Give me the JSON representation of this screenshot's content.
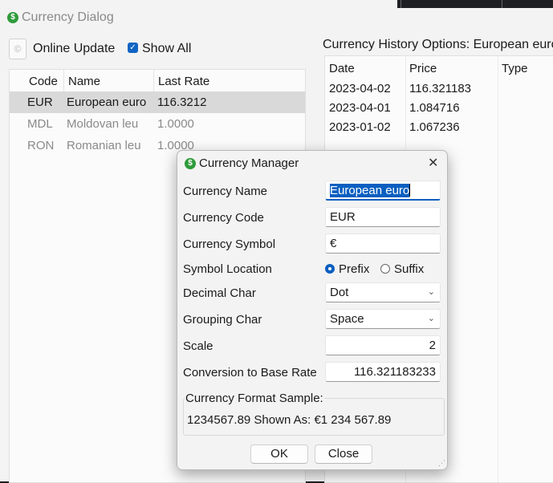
{
  "window": {
    "title": "Currency Dialog",
    "icon": "currency-coin-icon"
  },
  "toolbar": {
    "online_update_label": "Online Update",
    "show_all_label": "Show All",
    "show_all_checked": true
  },
  "currency_list": {
    "columns": [
      "Code",
      "Name",
      "Last Rate"
    ],
    "rows": [
      {
        "code": "EUR",
        "name": "European euro",
        "rate": "116.3212",
        "selected": true
      },
      {
        "code": "MDL",
        "name": "Moldovan leu",
        "rate": "1.0000",
        "selected": false
      },
      {
        "code": "RON",
        "name": "Romanian leu",
        "rate": "1.0000",
        "selected": false
      }
    ]
  },
  "history": {
    "title": "Currency History Options: European euro",
    "columns": [
      "Date",
      "Price",
      "Type"
    ],
    "rows": [
      {
        "date": "2023-04-02",
        "price": "116.321183"
      },
      {
        "date": "2023-04-01",
        "price": "1.084716"
      },
      {
        "date": "2023-01-02",
        "price": "1.067236"
      }
    ]
  },
  "manager": {
    "title": "Currency Manager",
    "close_glyph": "✕",
    "fields": {
      "name_label": "Currency Name",
      "name_value": "European euro",
      "code_label": "Currency Code",
      "code_value": "EUR",
      "symbol_label": "Currency Symbol",
      "symbol_value": "€",
      "location_label": "Symbol Location",
      "prefix_label": "Prefix",
      "suffix_label": "Suffix",
      "decimal_label": "Decimal Char",
      "decimal_value": "Dot",
      "grouping_label": "Grouping Char",
      "grouping_value": "Space",
      "scale_label": "Scale",
      "scale_value": "2",
      "conversion_label": "Conversion to Base Rate",
      "conversion_value": "116.321183233"
    },
    "sample": {
      "title": "Currency Format Sample:",
      "text": "1234567.89 Shown As: €1 234 567.89"
    },
    "buttons": {
      "ok": "OK",
      "close": "Close"
    },
    "colors": {
      "accent": "#0a5fc0",
      "coin": "#2e9b3a"
    }
  }
}
